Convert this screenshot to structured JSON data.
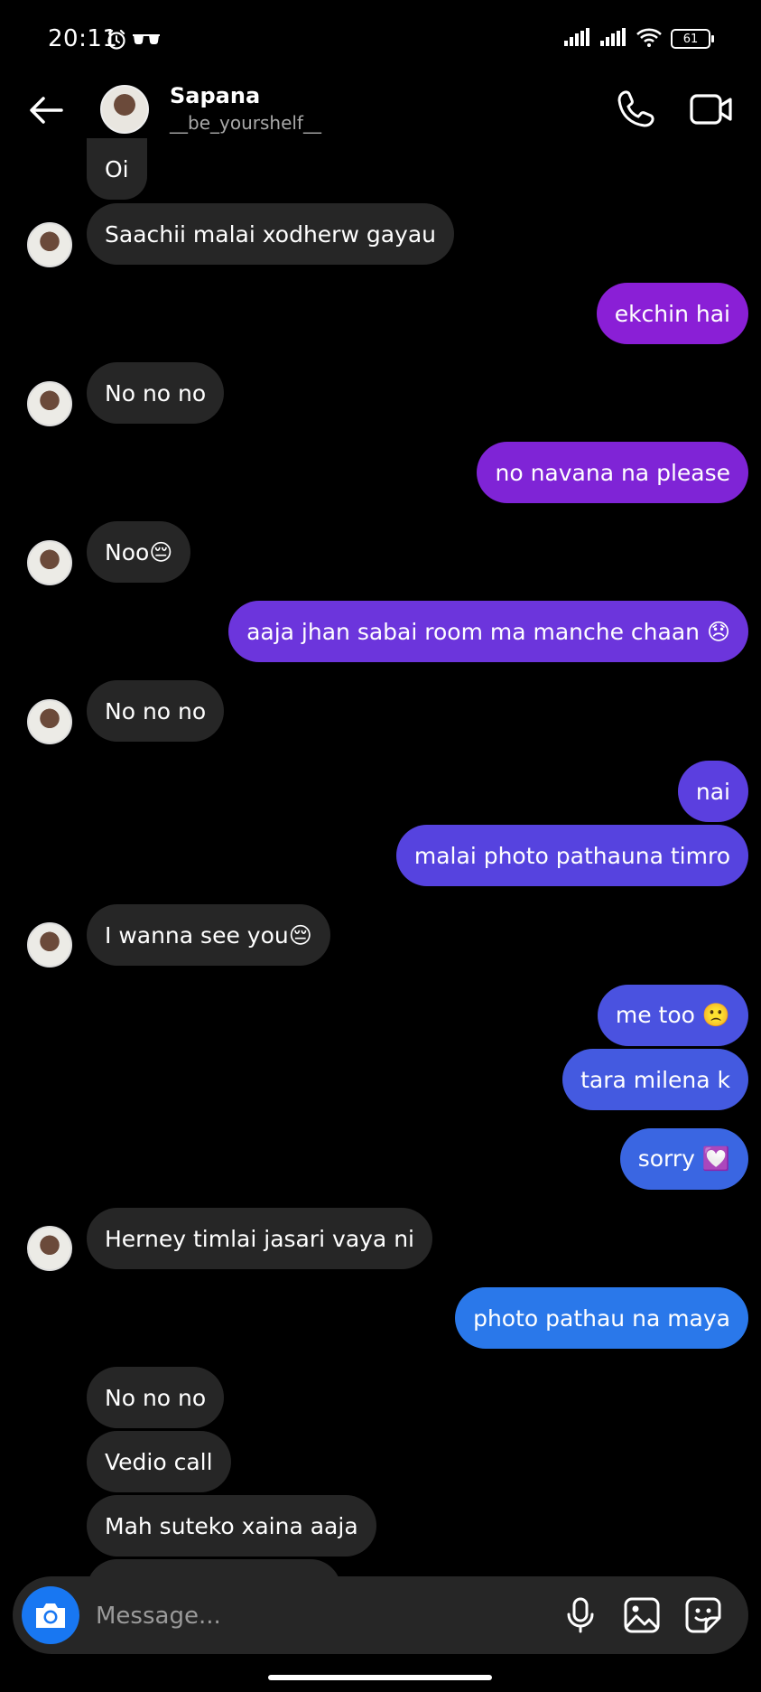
{
  "status": {
    "time": "20:11",
    "battery": "61"
  },
  "header": {
    "name": "Sapana",
    "username": "__be_yourshelf__"
  },
  "messages": [
    {
      "side": "recv",
      "text": "Oi",
      "avatar": false
    },
    {
      "side": "recv",
      "text": "Saachii malai xodherw gayau",
      "avatar": true
    },
    {
      "side": "sent",
      "text": "ekchin hai",
      "color": "#8a1fd6"
    },
    {
      "side": "recv",
      "text": "No no no",
      "avatar": true
    },
    {
      "side": "sent",
      "text": "no navana na please",
      "color": "#7f24d6"
    },
    {
      "side": "recv",
      "text": "Noo😔",
      "avatar": true
    },
    {
      "side": "sent",
      "text": "aaja jhan sabai room ma manche chaan 😞",
      "color": "#6c35dc"
    },
    {
      "side": "recv",
      "text": "No no no",
      "avatar": true
    },
    {
      "side": "sent",
      "text": "nai",
      "color": "#5b3fdf"
    },
    {
      "side": "sent",
      "text": "malai photo pathauna timro",
      "color": "#5643df"
    },
    {
      "side": "recv",
      "text": "I wanna see you😔",
      "avatar": true
    },
    {
      "side": "sent",
      "text": "me too 🙁",
      "color": "#4a52e0"
    },
    {
      "side": "sent",
      "text": "tara milena k",
      "color": "#445ae0"
    },
    {
      "side": "sent",
      "text": "sorry 💟",
      "color": "#3a66e2"
    },
    {
      "side": "recv",
      "text": "Herney timlai jasari vaya ni",
      "avatar": true
    },
    {
      "side": "sent",
      "text": "photo pathau na maya",
      "color": "#2a78ea"
    },
    {
      "side": "recv",
      "text": "No no no",
      "avatar": false
    },
    {
      "side": "recv",
      "text": "Vedio call",
      "avatar": false
    },
    {
      "side": "recv",
      "text": "Mah suteko xaina aaja",
      "avatar": false
    },
    {
      "side": "recv",
      "text": "",
      "avatar": false
    }
  ],
  "composer": {
    "placeholder": "Message..."
  },
  "icons": [
    "back-arrow-icon",
    "phone-icon",
    "video-camera-icon",
    "camera-icon",
    "microphone-icon",
    "gallery-icon",
    "sticker-icon",
    "alarm-icon",
    "glasses-icon",
    "signal-icon",
    "wifi-icon",
    "battery-icon"
  ]
}
